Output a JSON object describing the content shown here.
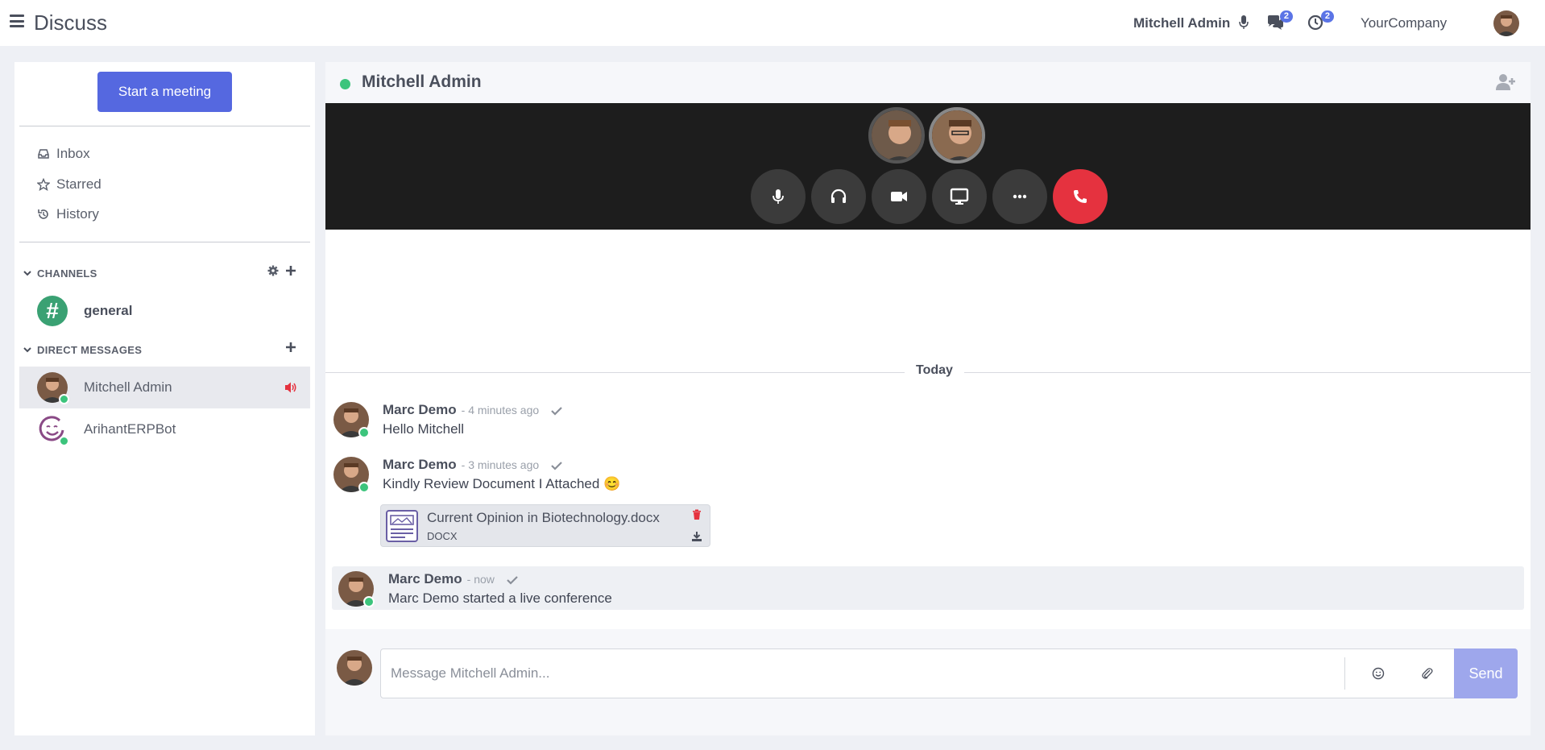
{
  "topbar": {
    "app_title": "Discuss",
    "user_name": "Mitchell Admin",
    "messages_badge": "2",
    "activity_badge": "2",
    "company": "YourCompany"
  },
  "sidebar": {
    "start_meeting_label": "Start a meeting",
    "nav": [
      {
        "label": "Inbox",
        "icon": "inbox-icon"
      },
      {
        "label": "Starred",
        "icon": "star-icon"
      },
      {
        "label": "History",
        "icon": "history-icon"
      }
    ],
    "channels_header": "CHANNELS",
    "channels": [
      {
        "name": "general"
      }
    ],
    "dm_header": "DIRECT MESSAGES",
    "direct_messages": [
      {
        "name": "Mitchell Admin",
        "active": true
      },
      {
        "name": "ArihantERPBot",
        "active": false
      }
    ]
  },
  "thread": {
    "title": "Mitchell Admin",
    "date_separator": "Today",
    "messages": [
      {
        "author": "Marc Demo",
        "when": "- 4 minutes ago",
        "text": "Hello Mitchell"
      },
      {
        "author": "Marc Demo",
        "when": "- 3 minutes ago",
        "text": "Kindly Review Document I Attached 😊",
        "attachment": {
          "name": "Current Opinion in Biotechnology.docx",
          "ext": "DOCX"
        }
      },
      {
        "author": "Marc Demo",
        "when": "- now",
        "text": "Marc Demo started a live conference"
      }
    ]
  },
  "composer": {
    "placeholder": "Message Mitchell Admin...",
    "send_label": "Send"
  },
  "colors": {
    "accent": "#5568e0",
    "online": "#3cc47c",
    "hangup": "#e5323f",
    "channel_icon": "#3aa173"
  }
}
